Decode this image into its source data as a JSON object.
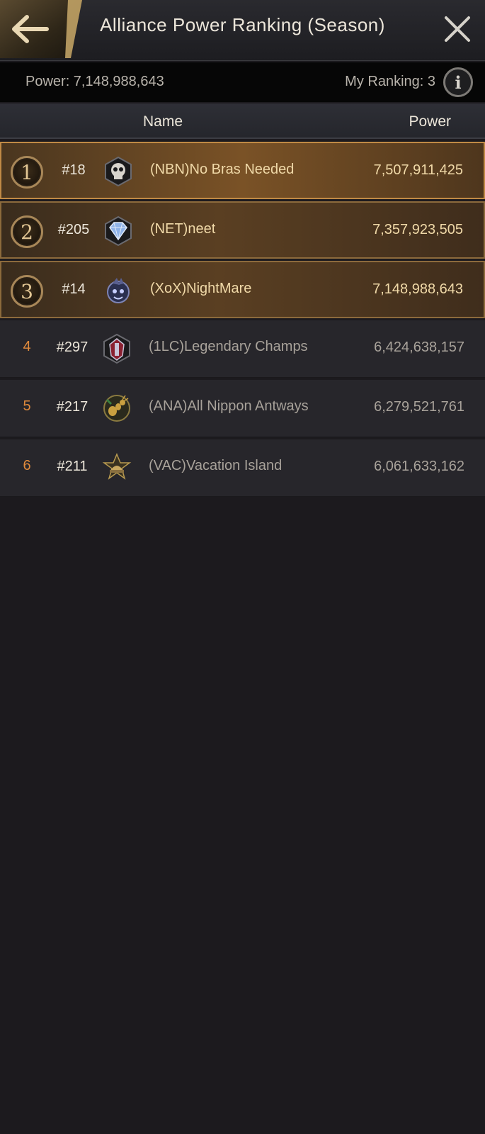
{
  "header": {
    "title": "Alliance Power Ranking (Season)"
  },
  "summary": {
    "power_text": "Power: 7,148,988,643",
    "my_ranking_text": "My Ranking: 3",
    "info_label": "i"
  },
  "columns": {
    "name": "Name",
    "power": "Power"
  },
  "rows": [
    {
      "rank": "1",
      "server": "#18",
      "alliance": "(NBN)No Bras Needed",
      "power": "7,507,911,425",
      "emblem": "skull-emblem-icon"
    },
    {
      "rank": "2",
      "server": "#205",
      "alliance": "(NET)neet",
      "power": "7,357,923,505",
      "emblem": "diamond-emblem-icon"
    },
    {
      "rank": "3",
      "server": "#14",
      "alliance": "(XoX)NightMare",
      "power": "7,148,988,643",
      "emblem": "beast-emblem-icon"
    },
    {
      "rank": "4",
      "server": "#297",
      "alliance": "(1LC)Legendary Champs",
      "power": "6,424,638,157",
      "emblem": "knight-emblem-icon"
    },
    {
      "rank": "5",
      "server": "#217",
      "alliance": "(ANA)All Nippon Antways",
      "power": "6,279,521,761",
      "emblem": "ant-emblem-icon"
    },
    {
      "rank": "6",
      "server": "#211",
      "alliance": "(VAC)Vacation Island",
      "power": "6,061,633,162",
      "emblem": "helmet-emblem-icon"
    }
  ],
  "colors": {
    "accent_gold": "#f0d9a8",
    "rank_orange": "#e08a3c",
    "background": "#1c1a1e"
  }
}
